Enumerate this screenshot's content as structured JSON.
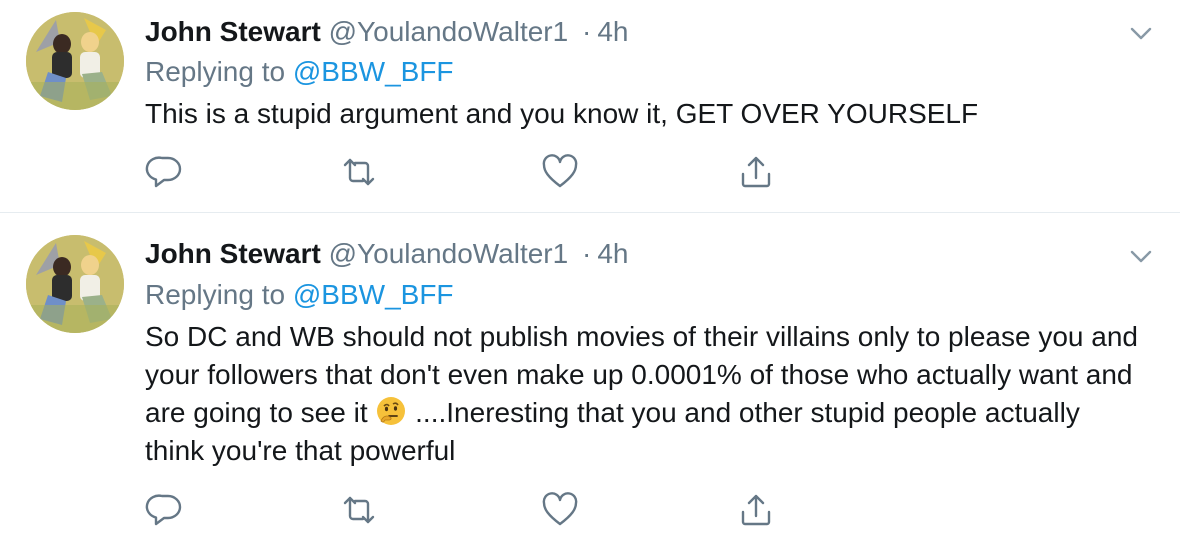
{
  "tweets": [
    {
      "name": "John Stewart",
      "handle": "@YoulandoWalter1",
      "separator": "·",
      "time": "4h",
      "replying_prefix": "Replying to",
      "replying_to": "@BBW_BFF",
      "text": "This is a stupid argument and you know it, GET OVER YOURSELF",
      "icons": {
        "caret": "chevron-down-icon",
        "reply": "reply-icon",
        "retweet": "retweet-icon",
        "like": "heart-icon",
        "share": "share-icon"
      }
    },
    {
      "name": "John Stewart",
      "handle": "@YoulandoWalter1",
      "separator": "·",
      "time": "4h",
      "replying_prefix": "Replying to",
      "replying_to": "@BBW_BFF",
      "text_before_emoji": "So DC and WB should not publish movies of their villains only to please you and your followers that don't even make up 0.0001% of those who actually want and are going to see it ",
      "emoji": "thinking-face-emoji",
      "text_after_emoji": " ....Ineresting that you and other stupid people actually think you're that powerful",
      "icons": {
        "caret": "chevron-down-icon",
        "reply": "reply-icon",
        "retweet": "retweet-icon",
        "like": "heart-icon",
        "share": "share-icon"
      }
    }
  ],
  "colors": {
    "text": "#14171a",
    "secondary": "#657786",
    "link": "#1b95e0",
    "divider": "#e6ecf0"
  }
}
